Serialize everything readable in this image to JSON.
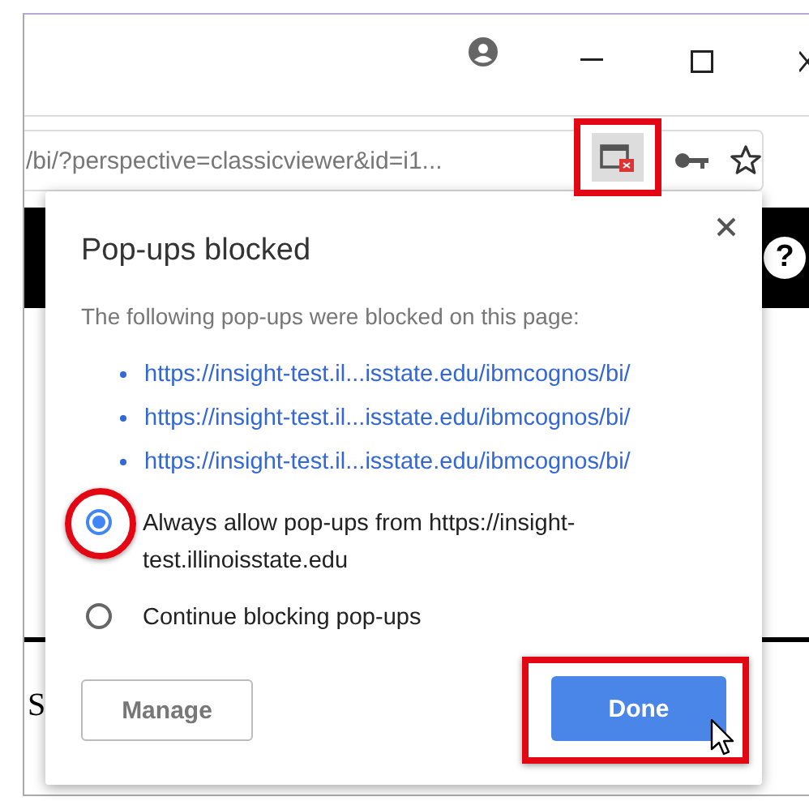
{
  "address_bar": {
    "url": "/bi/?perspective=classicviewer&id=i1..."
  },
  "page": {
    "help_glyph": "?",
    "text_fragment": "S"
  },
  "dialog": {
    "title": "Pop-ups blocked",
    "message": "The following pop-ups were blocked on this page:",
    "blocked_links": [
      "https://insight-test.il...isstate.edu/ibmcognos/bi/",
      "https://insight-test.il...isstate.edu/ibmcognos/bi/",
      "https://insight-test.il...isstate.edu/ibmcognos/bi/"
    ],
    "options": [
      {
        "label": "Always allow pop-ups from https://insight-test.illinoisstate.edu",
        "selected": true,
        "highlighted": true
      },
      {
        "label": "Continue blocking pop-ups",
        "selected": false,
        "highlighted": false
      }
    ],
    "buttons": [
      {
        "label": "Manage",
        "kind": "secondary",
        "highlighted": false
      },
      {
        "label": "Done",
        "kind": "primary",
        "highlighted": true
      }
    ]
  }
}
